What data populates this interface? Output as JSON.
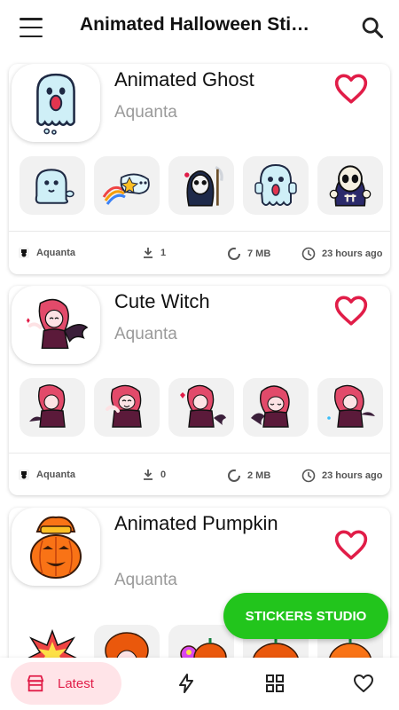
{
  "app": {
    "title": "Animated Halloween Sti…"
  },
  "colors": {
    "accent": "#e11d48",
    "fab": "#22c51c",
    "latest_bg": "#ffe4e8"
  },
  "icons": {
    "menu": "menu-icon",
    "search": "search-icon",
    "heart": "heart-outline-icon",
    "download": "download-icon",
    "size": "storage-ring-icon",
    "time": "clock-icon"
  },
  "packs": [
    {
      "title": "Animated Ghost",
      "author": "Aquanta",
      "meta_author": "Aquanta",
      "downloads": "1",
      "size": "7 MB",
      "time": "23 hours ago"
    },
    {
      "title": "Cute Witch",
      "author": "Aquanta",
      "meta_author": "Aquanta",
      "downloads": "0",
      "size": "2 MB",
      "time": "23 hours ago"
    },
    {
      "title": "Animated Pumpkin",
      "author": "Aquanta"
    }
  ],
  "fab": {
    "label": "STICKERS STUDIO"
  },
  "nav": {
    "latest_label": "Latest"
  }
}
